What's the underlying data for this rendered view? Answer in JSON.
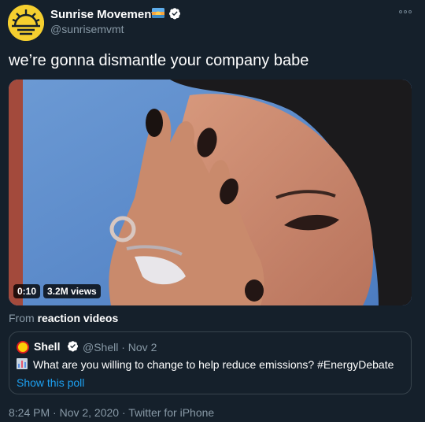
{
  "author": {
    "name": "Sunrise Movement",
    "handle": "@sunrisemvmt"
  },
  "tweet": {
    "text": "we’re gonna dismantle your company babe"
  },
  "video": {
    "duration": "0:10",
    "views": "3.2M views"
  },
  "source": {
    "prefix": "From",
    "name": "reaction videos"
  },
  "quote": {
    "name": "Shell",
    "meta": "@Shell · Nov 2",
    "text": "What are you willing to change to help reduce emissions? #EnergyDebate",
    "poll_link": "Show this poll"
  },
  "footer": {
    "timestamp": "8:24 PM · Nov 2, 2020 · Twitter for iPhone"
  },
  "colors": {
    "background": "#15202b",
    "secondary_text": "#8899a6",
    "link": "#1da1f2",
    "verified": "#ffffff",
    "border": "#38444d"
  },
  "icons": [
    "sunrise-logo-icon",
    "sunset-emoji-icon",
    "verified-icon",
    "more-icon",
    "shell-logo-icon",
    "bar-chart-icon"
  ]
}
